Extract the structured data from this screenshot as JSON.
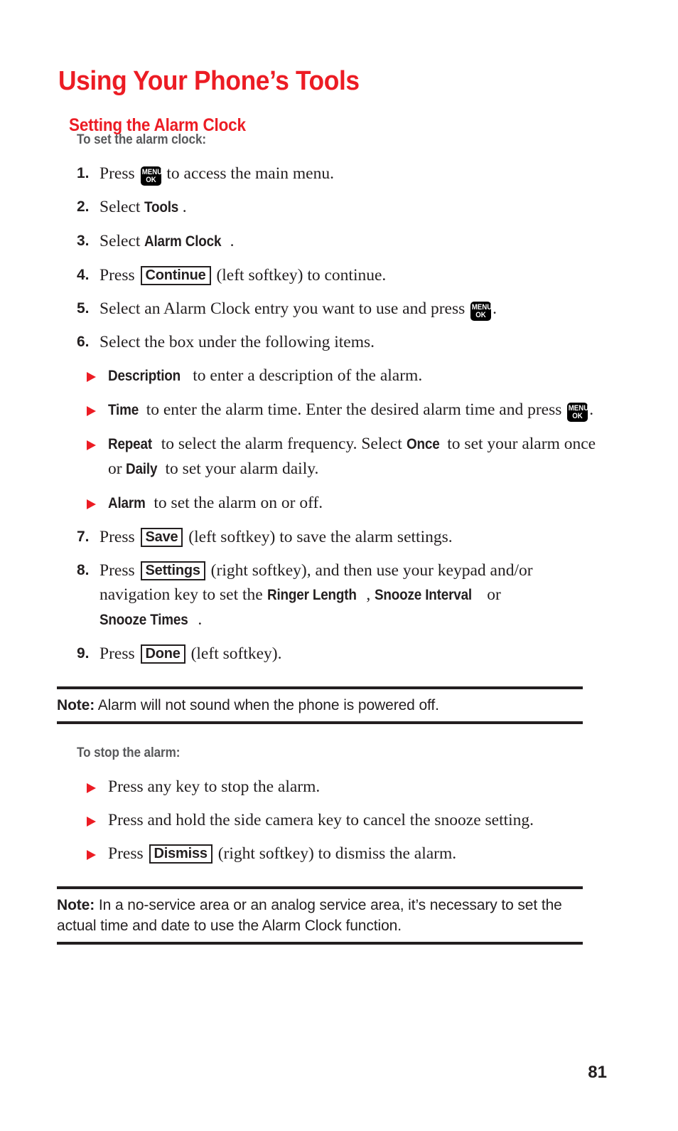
{
  "document": {
    "title": "Using Your Phone’s Tools",
    "section_title": "Setting the Alarm Clock",
    "page_number": "81",
    "accent_color": "#ec1c24",
    "heading_gray": "#58595b",
    "text_color": "#231f20"
  },
  "procedure_1": {
    "heading": "To set the alarm clock:",
    "steps": [
      {
        "number": "1.",
        "parts": [
          {
            "type": "text",
            "value": "Press "
          },
          {
            "type": "menukey",
            "line1": "MENU",
            "line2": "OK"
          },
          {
            "type": "text",
            "value": " to access the main menu."
          }
        ]
      },
      {
        "number": "2.",
        "parts": [
          {
            "type": "text",
            "value": "Select "
          },
          {
            "type": "term",
            "value": "Tools"
          },
          {
            "type": "text",
            "value": "."
          }
        ]
      },
      {
        "number": "3.",
        "parts": [
          {
            "type": "text",
            "value": "Select "
          },
          {
            "type": "term",
            "value": "Alarm Clock"
          },
          {
            "type": "text",
            "value": "."
          }
        ]
      },
      {
        "number": "4.",
        "parts": [
          {
            "type": "text",
            "value": "Press "
          },
          {
            "type": "softkey",
            "value": "Continue"
          },
          {
            "type": "text",
            "value": " (left softkey) to continue."
          }
        ]
      },
      {
        "number": "5.",
        "parts": [
          {
            "type": "text",
            "value": "Select an Alarm Clock entry you want to use and press "
          },
          {
            "type": "menukey",
            "line1": "MENU",
            "line2": "OK"
          },
          {
            "type": "text",
            "value": "."
          }
        ]
      },
      {
        "number": "6.",
        "parts": [
          {
            "type": "text",
            "value": "Select the box under the following items."
          }
        ]
      }
    ],
    "sub_bullets": [
      {
        "parts": [
          {
            "type": "term",
            "value": "Description"
          },
          {
            "type": "text",
            "value": " to enter a description of the alarm."
          }
        ]
      },
      {
        "parts": [
          {
            "type": "term",
            "value": "Time"
          },
          {
            "type": "text",
            "value": " to enter the alarm time. Enter the desired alarm time and press "
          },
          {
            "type": "menukey",
            "line1": "MENU",
            "line2": "OK"
          },
          {
            "type": "text",
            "value": "."
          }
        ]
      },
      {
        "parts": [
          {
            "type": "term",
            "value": "Repeat"
          },
          {
            "type": "text",
            "value": " to select the alarm frequency. Select "
          },
          {
            "type": "term",
            "value": "Once"
          },
          {
            "type": "text",
            "value": " to set your alarm once or "
          },
          {
            "type": "term",
            "value": "Daily"
          },
          {
            "type": "text",
            "value": " to set your alarm daily."
          }
        ]
      },
      {
        "parts": [
          {
            "type": "term",
            "value": "Alarm"
          },
          {
            "type": "text",
            "value": " to set the alarm on or off."
          }
        ]
      }
    ],
    "steps_after": [
      {
        "number": "7.",
        "parts": [
          {
            "type": "text",
            "value": "Press "
          },
          {
            "type": "softkey",
            "value": "Save"
          },
          {
            "type": "text",
            "value": " (left softkey) to save the alarm settings."
          }
        ]
      },
      {
        "number": "8.",
        "parts": [
          {
            "type": "text",
            "value": "Press "
          },
          {
            "type": "softkey",
            "value": "Settings"
          },
          {
            "type": "text",
            "value": " (right softkey), and then use your keypad and/or navigation key to set the "
          },
          {
            "type": "term",
            "value": "Ringer Length"
          },
          {
            "type": "text",
            "value": ", "
          },
          {
            "type": "term",
            "value": "Snooze Interval"
          },
          {
            "type": "text",
            "value": " or "
          },
          {
            "type": "term",
            "value": "Snooze Times"
          },
          {
            "type": "text",
            "value": "."
          }
        ]
      },
      {
        "number": "9.",
        "parts": [
          {
            "type": "text",
            "value": "Press "
          },
          {
            "type": "softkey",
            "value": "Done"
          },
          {
            "type": "text",
            "value": " (left softkey)."
          }
        ]
      }
    ]
  },
  "note_1": {
    "label": "Note:",
    "body": " Alarm will not sound when the phone is powered off."
  },
  "procedure_2": {
    "heading": "To stop the alarm:",
    "bullets": [
      {
        "parts": [
          {
            "type": "text",
            "value": "Press any key to stop the alarm."
          }
        ]
      },
      {
        "parts": [
          {
            "type": "text",
            "value": "Press and hold the side camera key to cancel the snooze setting."
          }
        ]
      },
      {
        "parts": [
          {
            "type": "text",
            "value": "Press "
          },
          {
            "type": "softkey",
            "value": "Dismiss"
          },
          {
            "type": "text",
            "value": " (right softkey) to dismiss the alarm."
          }
        ]
      }
    ]
  },
  "note_2": {
    "label": "Note:",
    "body": " In a no-service area or an analog service area, it’s necessary to set the actual time and date to use the Alarm Clock function."
  }
}
